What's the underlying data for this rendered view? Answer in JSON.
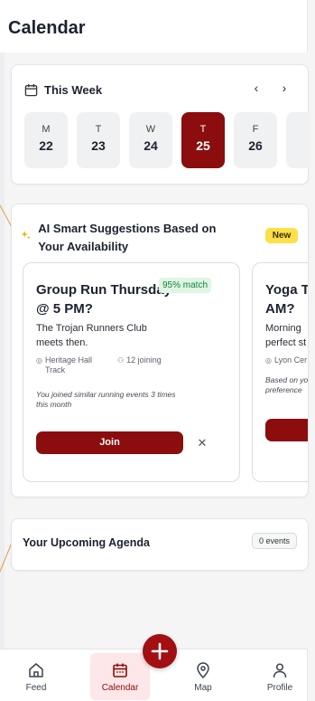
{
  "header": {
    "title": "Calendar"
  },
  "week": {
    "title": "This Week",
    "prev": "‹",
    "next": "›",
    "days": [
      {
        "letter": "M",
        "num": "22"
      },
      {
        "letter": "T",
        "num": "23"
      },
      {
        "letter": "W",
        "num": "24"
      },
      {
        "letter": "T",
        "num": "25",
        "active": true
      },
      {
        "letter": "F",
        "num": "26"
      },
      {
        "letter": "",
        "num": ""
      }
    ]
  },
  "suggestions": {
    "title": "AI Smart Suggestions Based on Your Availability",
    "badge": "New",
    "events": [
      {
        "title": "Group Run Thursday @ 5 PM?",
        "match": "95% match",
        "desc": "The Trojan Runners Club meets then.",
        "location": "Heritage Hall Track",
        "joining": "12 joining",
        "note": "You joined similar running events 3 times this month",
        "join_label": "Join",
        "dismiss_label": "✕"
      },
      {
        "title": "Yoga To AM?",
        "desc": "Morning perfect st",
        "location": "Lyon Cer",
        "note": "Based on yo preference",
        "join_label": ""
      }
    ]
  },
  "agenda": {
    "title": "Your Upcoming Agenda",
    "count": "0 events"
  },
  "nav": {
    "items": [
      {
        "label": "Feed",
        "icon": "home-icon"
      },
      {
        "label": "Calendar",
        "icon": "calendar-icon",
        "active": true
      },
      {
        "label": "Map",
        "icon": "map-pin-icon"
      },
      {
        "label": "Profile",
        "icon": "profile-icon"
      }
    ],
    "fab": "+"
  },
  "colors": {
    "accent": "#8b0d0d",
    "active_bg": "#fde7e8",
    "badge_yellow": "#fde047",
    "match_green": "#15803d"
  }
}
